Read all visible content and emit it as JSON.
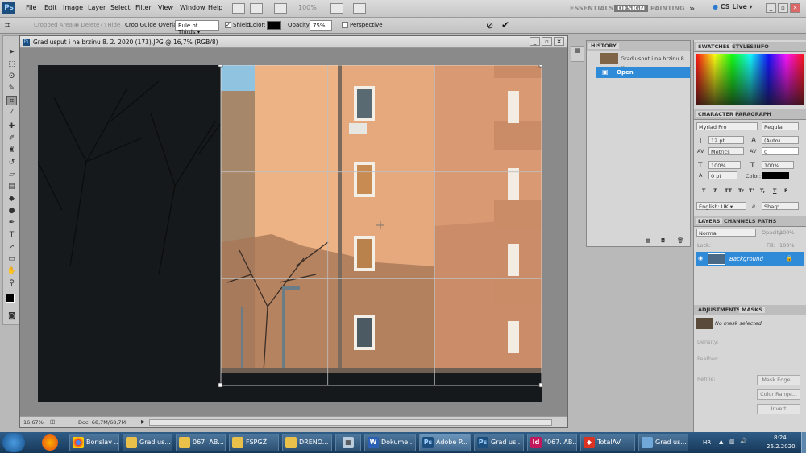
{
  "menubar": {
    "logo": "Ps",
    "items": [
      "File",
      "Edit",
      "Image",
      "Layer",
      "Select",
      "Filter",
      "View",
      "Window",
      "Help"
    ],
    "zoom": "100%",
    "workspaces": [
      "ESSENTIALS",
      "DESIGN",
      "PAINTING"
    ],
    "overflow": "»",
    "cslive": "CS Live"
  },
  "options": {
    "crop_area": "Cropped Area:",
    "delete": "Delete",
    "hide": "Hide",
    "overlay_label": "Crop Guide Overlay:",
    "overlay_value": "Rule of Thirds",
    "shield": "Shield",
    "color": "Color:",
    "opacity": "Opacity:",
    "opacity_value": "75%",
    "perspective": "Perspective"
  },
  "document": {
    "title": "Grad usput i na brzinu 8. 2. 2020 (173).JPG @ 16,7% (RGB/8)",
    "zoom": "16,67%",
    "doc_size": "Doc: 68,7M/68,7M"
  },
  "history": {
    "tab": "HISTORY",
    "snapshot": "Grad usput i na brzinu 8. ...",
    "state": "Open"
  },
  "swatches": {
    "tabs": [
      "SWATCHES",
      "STYLES",
      "INFO"
    ]
  },
  "character": {
    "tabs": [
      "CHARACTER",
      "PARAGRAPH"
    ],
    "font": "Myriad Pro",
    "style": "Regular",
    "size": "12 pt",
    "leading": "(Auto)",
    "kerning": "Metrics",
    "tracking": "0",
    "vscale": "100%",
    "hscale": "100%",
    "baseline": "0 pt",
    "color": "Color:",
    "glyphs": [
      "T",
      "T",
      "TT",
      "Tr",
      "T'",
      "T,",
      "T",
      "F"
    ],
    "language": "English: UK",
    "aa": "a",
    "aa_value": "Sharp"
  },
  "layers": {
    "tabs": [
      "LAYERS",
      "CHANNELS",
      "PATHS"
    ],
    "blend": "Normal",
    "opacity": "Opacity:",
    "opacity_value": "100%",
    "lock": "Lock:",
    "fill": "Fill:",
    "fill_value": "100%",
    "layer": "Background"
  },
  "masks": {
    "tabs": [
      "ADJUSTMENTS",
      "MASKS"
    ],
    "status": "No mask selected",
    "density": "Density:",
    "feather": "Feather:",
    "refine": "Refine:",
    "mask_edge": "Mask Edge...",
    "color_range": "Color Range...",
    "invert": "Invert"
  },
  "taskbar": {
    "items": [
      {
        "label": "Borislav ..."
      },
      {
        "label": "Grad us..."
      },
      {
        "label": "067. AB..."
      },
      {
        "label": "FSPGŽ"
      },
      {
        "label": "DRENO..."
      },
      {
        "label": ""
      },
      {
        "label": "Dokume..."
      },
      {
        "label": "Adobe P..."
      },
      {
        "label": "Grad us..."
      },
      {
        "label": "°067. AB..."
      },
      {
        "label": "TotalAV"
      },
      {
        "label": "Grad us..."
      }
    ],
    "lang": "HR",
    "time": "8:24",
    "date": "26.2.2020."
  },
  "colors": {
    "accent": "#3b8fd6",
    "brand": "#1c4f7e",
    "selection": "#2f8ad8"
  }
}
